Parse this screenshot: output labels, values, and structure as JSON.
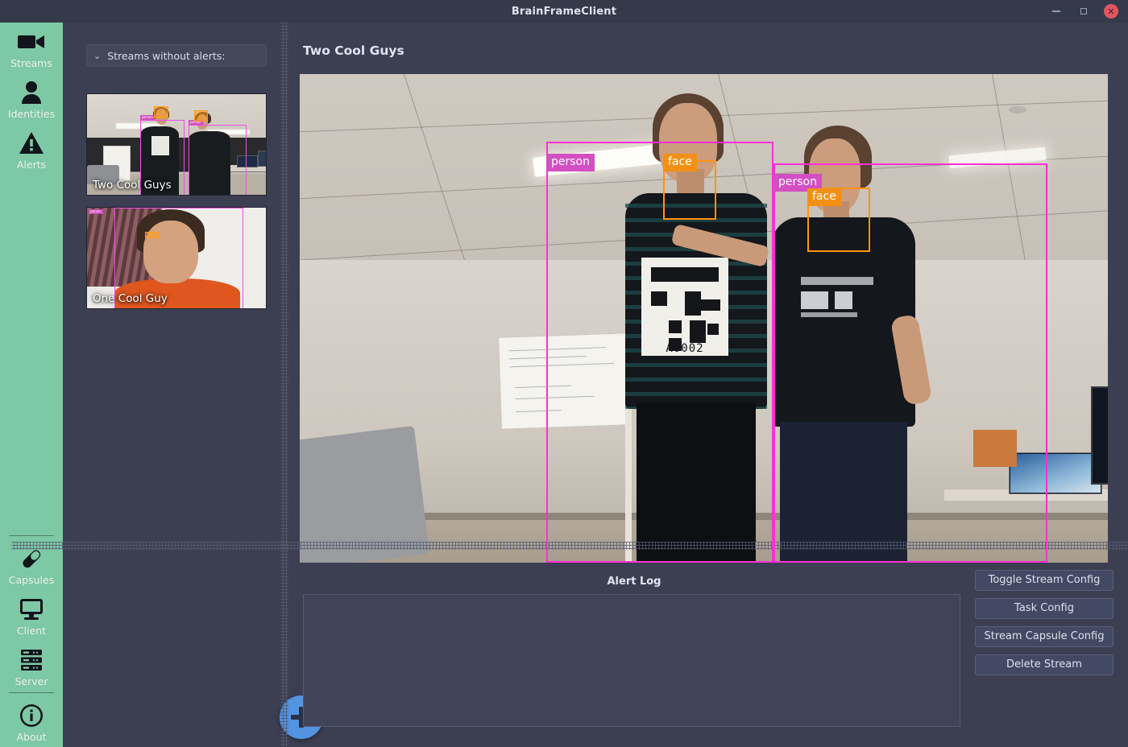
{
  "window": {
    "title": "BrainFrameClient",
    "controls": [
      {
        "name": "minimize",
        "glyph": "–"
      },
      {
        "name": "maximize",
        "glyph": "◲"
      },
      {
        "name": "close",
        "glyph": "✕"
      }
    ]
  },
  "rail": {
    "top_items": [
      {
        "icon": "video-camera-icon",
        "label": "Streams",
        "active": true
      },
      {
        "icon": "person-icon",
        "label": "Identities",
        "active": false
      },
      {
        "icon": "warning-triangle-icon",
        "label": "Alerts",
        "active": false
      }
    ],
    "bottom_items": [
      {
        "icon": "capsule-pill-icon",
        "label": "Capsules"
      },
      {
        "icon": "desktop-monitor-icon",
        "label": "Client"
      },
      {
        "icon": "server-rack-icon",
        "label": "Server"
      },
      {
        "icon": "info-circle-icon",
        "label": "About"
      }
    ]
  },
  "left_panel": {
    "header_label": "Streams without alerts:",
    "header_chevron": "⌄",
    "streams": [
      {
        "name": "Two Cool Guys",
        "selected": true
      },
      {
        "name": "One Cool Guy",
        "selected": false
      }
    ],
    "add_stream_button": "+"
  },
  "main": {
    "page_title": "Two Cool Guys",
    "detections": [
      {
        "label": "person",
        "class": "person"
      },
      {
        "label": "face",
        "class": "face"
      },
      {
        "label": "person",
        "class": "person"
      },
      {
        "label": "face",
        "class": "face"
      }
    ],
    "shirt_code": "A0002"
  },
  "alert_log": {
    "title": "Alert Log",
    "entries": []
  },
  "actions": {
    "buttons": [
      "Toggle Stream Config",
      "Task Config",
      "Stream Capsule Config",
      "Delete Stream"
    ]
  },
  "colors": {
    "rail_green": "#7ec9a5",
    "background": "#3c3f52",
    "titlebar": "#343a49",
    "accent_blue": "#5294e2",
    "person_box": "#ff2fd6",
    "face_box": "#ff9410",
    "close_red": "#e05561"
  }
}
